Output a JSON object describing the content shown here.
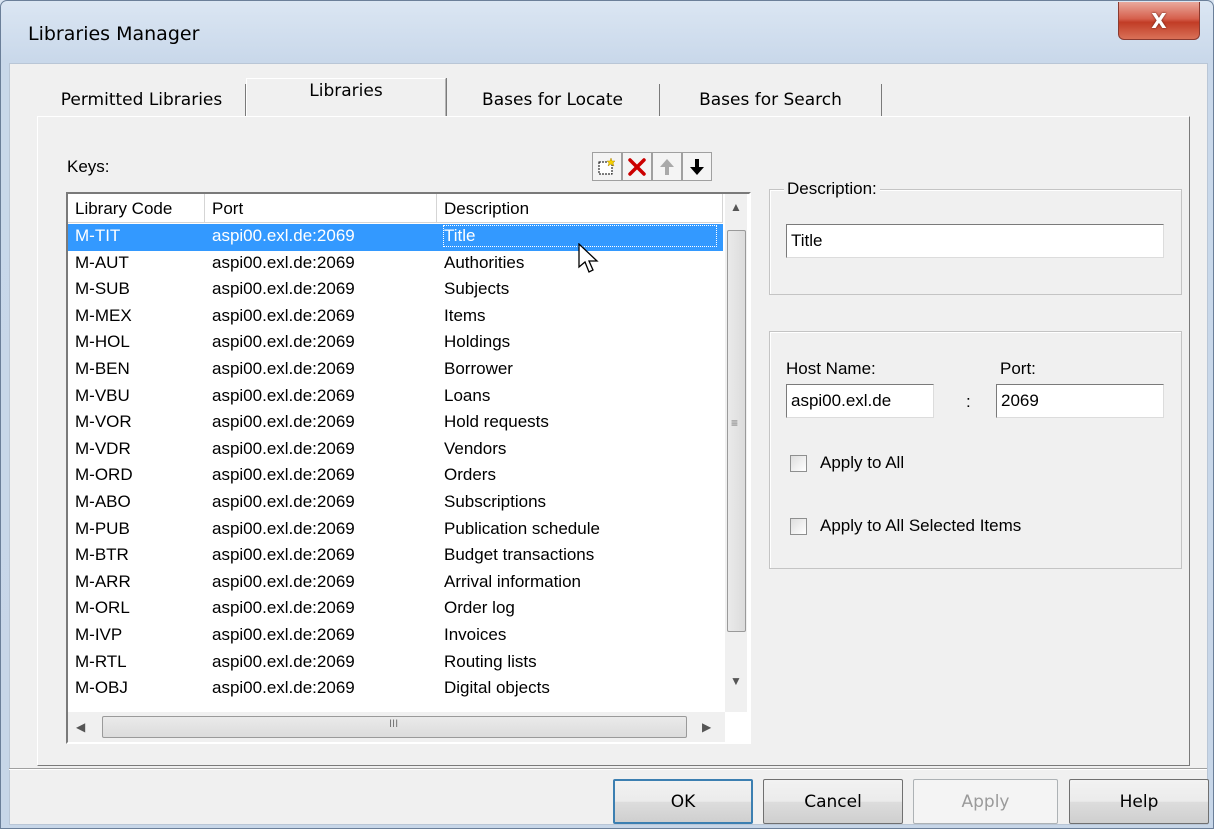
{
  "window": {
    "title": "Libraries Manager",
    "close_glyph": "X"
  },
  "tabs": [
    {
      "label": "Permitted Libraries",
      "active": false
    },
    {
      "label": "Libraries",
      "active": true
    },
    {
      "label": "Bases for Locate",
      "active": false
    },
    {
      "label": "Bases for Search",
      "active": false
    }
  ],
  "keys": {
    "label": "Keys:",
    "toolbar": [
      "new-icon",
      "delete-icon",
      "move-up-icon",
      "move-down-icon"
    ]
  },
  "list": {
    "columns": [
      "Library Code",
      "Port",
      "Description"
    ],
    "rows": [
      {
        "code": "M-TIT",
        "port": "aspi00.exl.de:2069",
        "description": "Title",
        "selected": true
      },
      {
        "code": "M-AUT",
        "port": "aspi00.exl.de:2069",
        "description": "Authorities"
      },
      {
        "code": "M-SUB",
        "port": "aspi00.exl.de:2069",
        "description": "Subjects"
      },
      {
        "code": "M-MEX",
        "port": "aspi00.exl.de:2069",
        "description": "Items"
      },
      {
        "code": "M-HOL",
        "port": "aspi00.exl.de:2069",
        "description": "Holdings"
      },
      {
        "code": "M-BEN",
        "port": "aspi00.exl.de:2069",
        "description": "Borrower"
      },
      {
        "code": "M-VBU",
        "port": "aspi00.exl.de:2069",
        "description": "Loans"
      },
      {
        "code": "M-VOR",
        "port": "aspi00.exl.de:2069",
        "description": "Hold requests"
      },
      {
        "code": "M-VDR",
        "port": "aspi00.exl.de:2069",
        "description": "Vendors"
      },
      {
        "code": "M-ORD",
        "port": "aspi00.exl.de:2069",
        "description": "Orders"
      },
      {
        "code": "M-ABO",
        "port": "aspi00.exl.de:2069",
        "description": "Subscriptions"
      },
      {
        "code": "M-PUB",
        "port": "aspi00.exl.de:2069",
        "description": "Publication schedule"
      },
      {
        "code": "M-BTR",
        "port": "aspi00.exl.de:2069",
        "description": "Budget transactions"
      },
      {
        "code": "M-ARR",
        "port": "aspi00.exl.de:2069",
        "description": "Arrival information"
      },
      {
        "code": "M-ORL",
        "port": "aspi00.exl.de:2069",
        "description": "Order log"
      },
      {
        "code": "M-IVP",
        "port": "aspi00.exl.de:2069",
        "description": "Invoices"
      },
      {
        "code": "M-RTL",
        "port": "aspi00.exl.de:2069",
        "description": "Routing lists"
      },
      {
        "code": "M-OBJ",
        "port": "aspi00.exl.de:2069",
        "description": "Digital objects"
      }
    ],
    "hscroll_thumb_glyph": "III",
    "vscroll_grip_glyph": "≡"
  },
  "description_group": {
    "title": "Description:",
    "value": "Title"
  },
  "host_group": {
    "host_label": "Host Name:",
    "host_value": "aspi00.exl.de",
    "separator": ":",
    "port_label": "Port:",
    "port_value": "2069",
    "apply_all_label": "Apply to All",
    "apply_all_checked": false,
    "apply_selected_label": "Apply to All Selected Items",
    "apply_selected_checked": false
  },
  "buttons": {
    "ok": "OK",
    "cancel": "Cancel",
    "apply": "Apply",
    "help": "Help"
  },
  "colors": {
    "selection": "#3399ff",
    "close_button": "#c74430",
    "delete_icon": "#cc0000"
  }
}
